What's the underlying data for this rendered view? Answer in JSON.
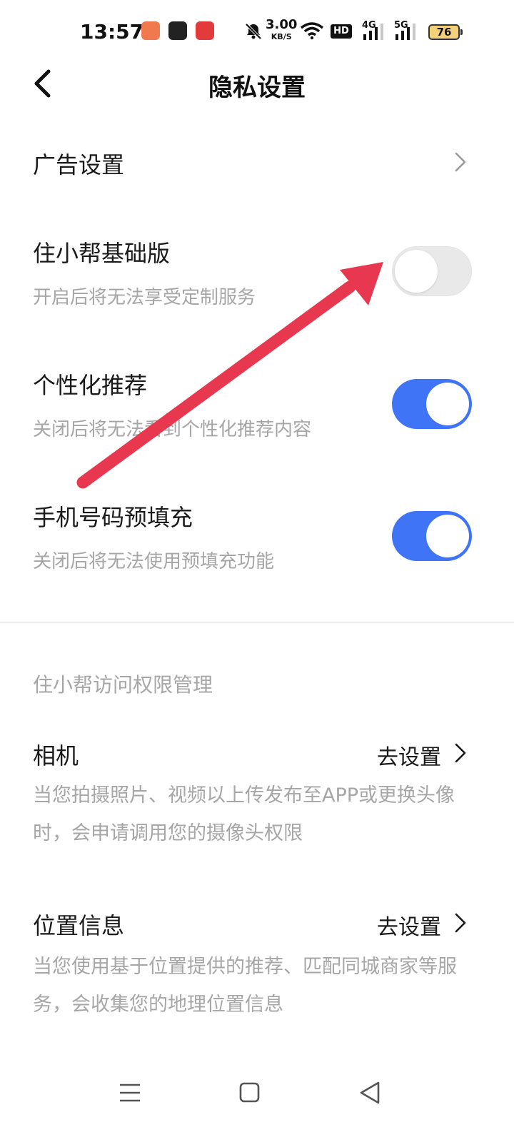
{
  "status_bar": {
    "time": "13:57",
    "net_speed": "3.00",
    "net_speed_unit": "KB/S",
    "hd_badge": "HD",
    "signal_1_label": "4G",
    "signal_2_label": "5G",
    "battery": "76"
  },
  "header": {
    "title": "隐私设置"
  },
  "settings": [
    {
      "title": "广告设置",
      "type": "link"
    },
    {
      "title": "住小帮基础版",
      "desc": "开启后将无法享受定制服务",
      "type": "toggle",
      "on": false
    },
    {
      "title": "个性化推荐",
      "desc": "关闭后将无法看到个性化推荐内容",
      "type": "toggle",
      "on": true
    },
    {
      "title": "手机号码预填充",
      "desc": "关闭后将无法使用预填充功能",
      "type": "toggle",
      "on": true
    }
  ],
  "permissions": {
    "section_title": "住小帮访问权限管理",
    "items": [
      {
        "title": "相机",
        "action": "去设置",
        "desc": "当您拍摄照片、视频以上传发布至APP或更换头像时，会申请调用您的摄像头权限"
      },
      {
        "title": "位置信息",
        "action": "去设置",
        "desc": "当您使用基于位置提供的推荐、匹配同城商家等服务，会收集您的地理位置信息"
      }
    ]
  },
  "colors": {
    "accent": "#3e74f5",
    "toggle_off": "#e9e9e9",
    "annotation_arrow": "#e8384f"
  }
}
